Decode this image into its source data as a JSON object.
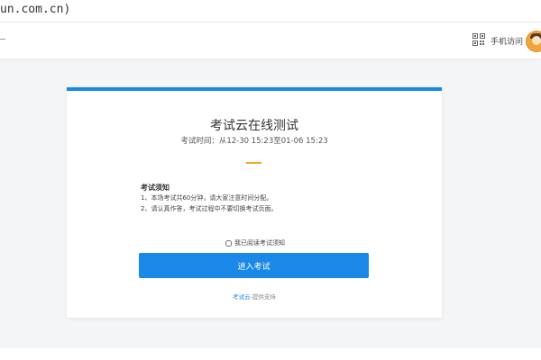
{
  "browser": {
    "url_fragment": "un.com.cn)"
  },
  "header": {
    "mobile_access_label": "手机访问"
  },
  "card": {
    "title": "考试云在线测试",
    "time": "考试时间：从12-30 15:23至01-06 15:23",
    "notice": {
      "title": "考试须知",
      "items": [
        "1、本场考试共60分钟，请大家注意时间分配。",
        "2、请认真作答，考试过程中不要切换考试页面。"
      ]
    },
    "agree_label": "我已阅读考试须知",
    "agree_checked": false,
    "start_button_label": "进入考试",
    "support": {
      "brand": "考试云",
      "suffix": "-提供支持"
    }
  },
  "colors": {
    "accent": "#1a88e6",
    "divider": "#f5a623",
    "background": "#f4f5f7"
  },
  "icons": {
    "mobile": "qr-code-icon",
    "avatar": "user-avatar",
    "back": "back-icon"
  }
}
